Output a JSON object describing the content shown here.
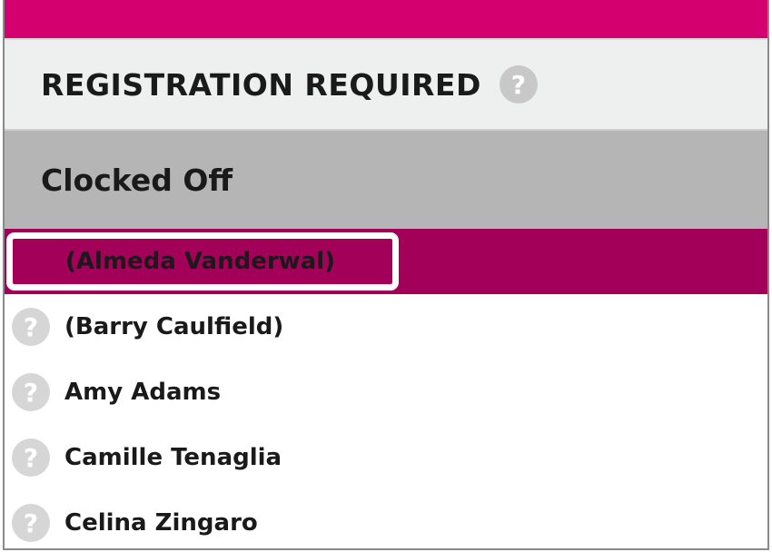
{
  "header": {
    "title": "REGISTRATION REQUIRED",
    "help_glyph": "?",
    "help_icon": "question-circle-icon"
  },
  "group": {
    "title": "Clocked Off"
  },
  "selected_item": {
    "label": "(Almeda Vanderwal)"
  },
  "people": [
    {
      "label": "(Barry Caulfield)",
      "icon": "question-circle-icon",
      "glyph": "?"
    },
    {
      "label": "Amy Adams",
      "icon": "question-circle-icon",
      "glyph": "?"
    },
    {
      "label": "Camille Tenaglia",
      "icon": "question-circle-icon",
      "glyph": "?"
    },
    {
      "label": "Celina Zingaro",
      "icon": "question-circle-icon",
      "glyph": "?"
    }
  ],
  "colors": {
    "accent": "#d4006f",
    "selected_row": "#a3005a",
    "header_bg": "#eef0ef",
    "group_bg": "#b5b5b5",
    "icon_gray": "#c8c8c8"
  }
}
